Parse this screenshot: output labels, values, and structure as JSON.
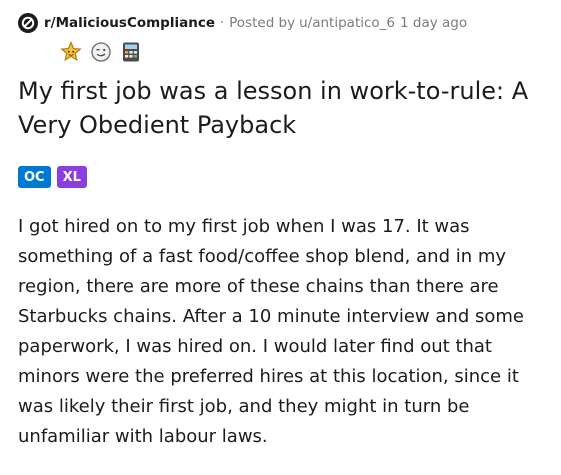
{
  "header": {
    "subreddit": "r/MaliciousCompliance",
    "separator": "·",
    "posted_by_label": "Posted by",
    "username": "u/antipatico_6",
    "time": "1 day ago"
  },
  "awards": [
    {
      "name": "gold-star-award-icon"
    },
    {
      "name": "wink-face-award-icon"
    },
    {
      "name": "calculator-award-icon"
    }
  ],
  "post": {
    "title": "My first job was a lesson in work-to-rule: A Very Obedient Payback",
    "flairs": [
      {
        "label": "OC",
        "color": "#0079d3"
      },
      {
        "label": "XL",
        "color": "#8b3ee0"
      }
    ],
    "body": "I got hired on to my first job when I was 17. It was something of a fast food/coffee shop blend, and in my region, there are more of these chains than there are Starbucks chains. After a 10 minute interview and some paperwork, I was hired on. I would later find out that minors were the preferred hires at this location, since it was likely their first job, and they might in turn be unfamiliar with labour laws."
  },
  "colors": {
    "text": "#1c1c1c",
    "meta": "#7c7c7c",
    "flair_oc": "#0079d3",
    "flair_xl": "#8b3ee0"
  }
}
